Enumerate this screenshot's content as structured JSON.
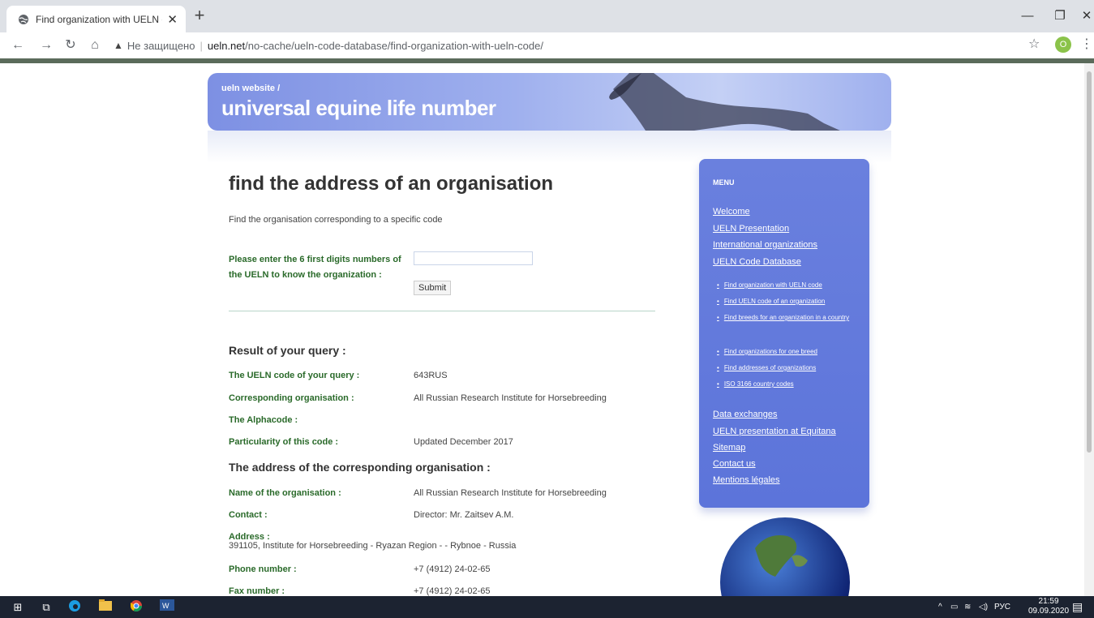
{
  "browser": {
    "tab_title": "Find organization with UELN cod",
    "new_tab": "+",
    "omnibox": {
      "security_label": "Не защищено",
      "host": "ueln.net",
      "path": "/no-cache/ueln-code-database/find-organization-with-ueln-code/"
    },
    "profile_initial": "O"
  },
  "banner": {
    "subtitle": "ueln website /",
    "title": "universal equine life number"
  },
  "main": {
    "heading": "find the address of an organisation",
    "intro": "Find the organisation corresponding to a specific code",
    "form": {
      "label": "Please enter the 6 first digits numbers of the UELN to know the organization :",
      "input_value": "",
      "submit_label": "Submit"
    },
    "result_heading": "Result of your query :",
    "result_rows": [
      {
        "label": "The UELN code of your query :",
        "value": "643RUS"
      },
      {
        "label": "Corresponding organisation :",
        "value": "All Russian Research Institute for Horsebreeding"
      },
      {
        "label": "The Alphacode :",
        "value": ""
      },
      {
        "label": "Particularity of this code :",
        "value": "Updated December 2017"
      }
    ],
    "address_heading": "The address of the corresponding organisation :",
    "address_rows": [
      {
        "label": "Name of the organisation :",
        "value": "All Russian Research Institute for Horsebreeding"
      },
      {
        "label": "Contact :",
        "value": "Director: Mr. Zaitsev A.M."
      }
    ],
    "address_label": "Address :",
    "address_value": "391105, Institute for Horsebreeding - Ryazan Region - - Rybnoe - Russia",
    "phone_label": "Phone number :",
    "phone_value": "+7 (4912) 24-02-65",
    "fax_label": "Fax number :",
    "fax_value": "+7 (4912) 24-02-65"
  },
  "menu": {
    "title": "MENU",
    "top_links": [
      "Welcome",
      "UELN Presentation",
      "International organizations",
      "UELN Code Database"
    ],
    "sub_links": [
      "Find organization with UELN code",
      "Find UELN code of an organization",
      "Find breeds for an organization in a country",
      "Find organizations for one breed",
      "Find addresses of organizations",
      "ISO 3166 country codes"
    ],
    "bottom_links": [
      "Data exchanges",
      "UELN presentation at Equitana",
      "Sitemap",
      "Contact us",
      "Mentions légales"
    ]
  },
  "taskbar": {
    "language": "РУС",
    "time": "21:59",
    "date": "09.09.2020"
  }
}
